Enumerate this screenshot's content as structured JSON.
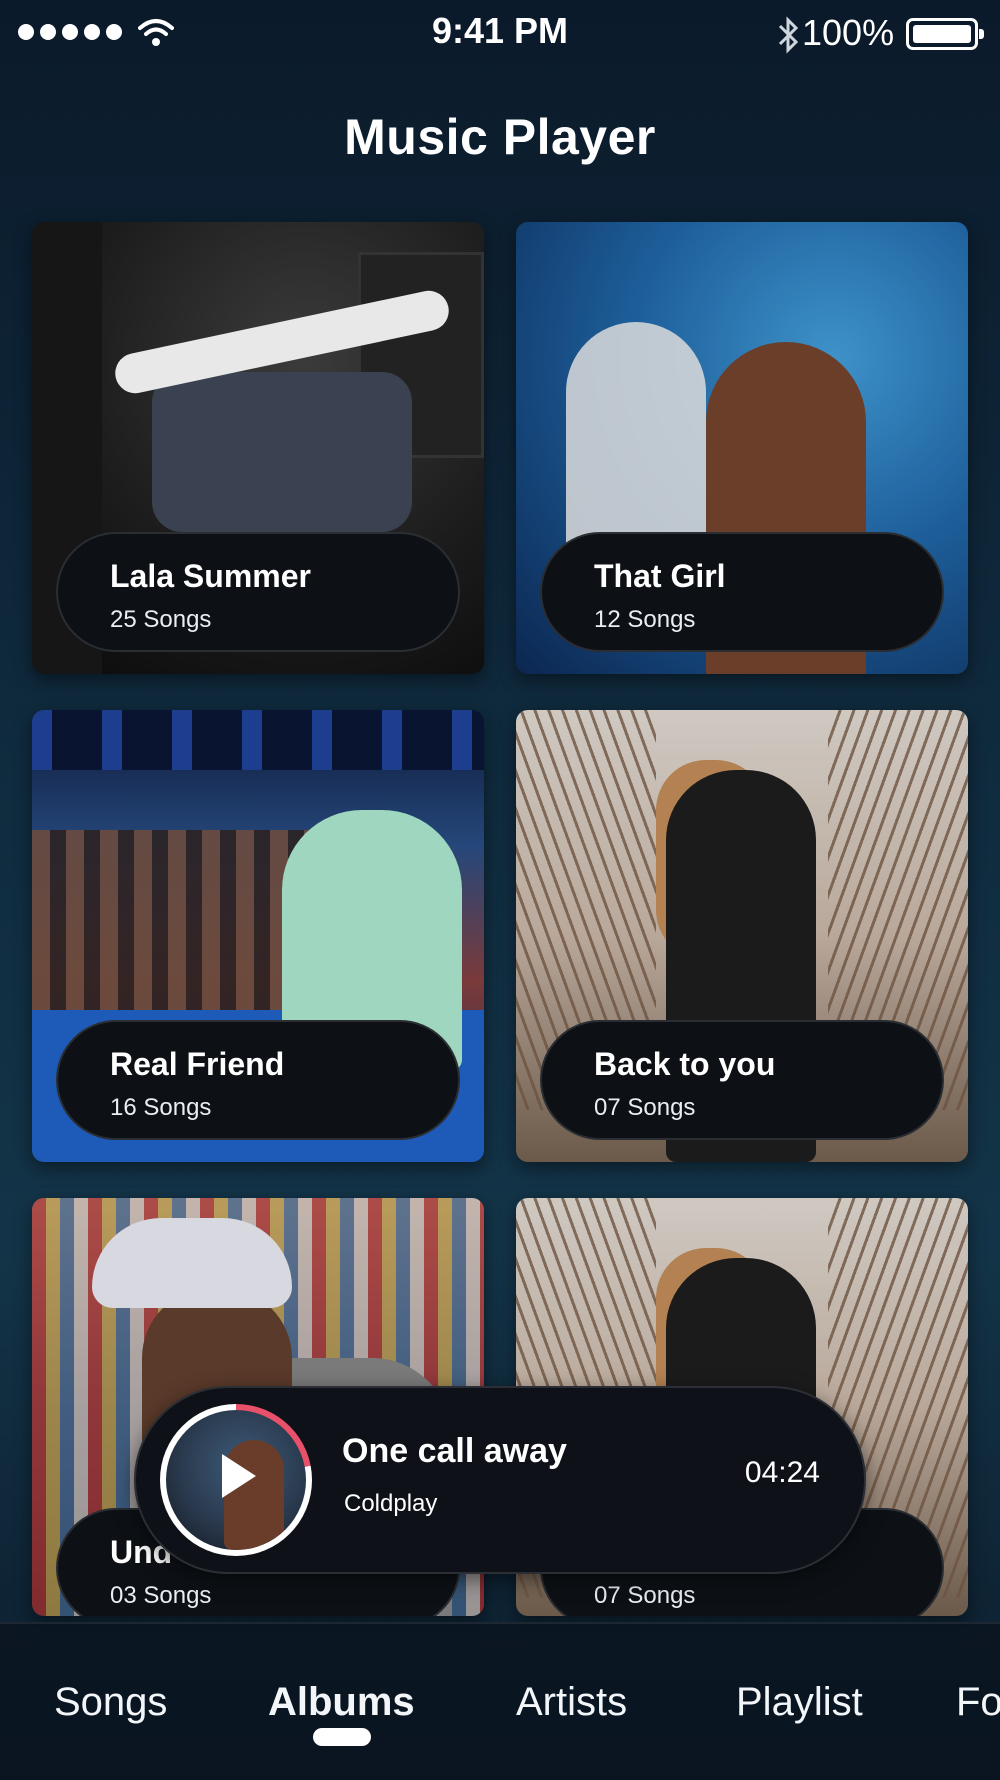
{
  "status_bar": {
    "time": "9:41 PM",
    "battery": "100%"
  },
  "title": "Music Player",
  "albums": [
    {
      "title": "Lala Summer",
      "songs": "25 Songs"
    },
    {
      "title": "That Girl",
      "songs": "12 Songs"
    },
    {
      "title": "Real Friend",
      "songs": "16 Songs"
    },
    {
      "title": "Back to you",
      "songs": "07 Songs"
    },
    {
      "title": "Und",
      "songs": "03 Songs"
    },
    {
      "title": "",
      "songs": "07 Songs"
    }
  ],
  "now_playing": {
    "title": "One call away",
    "artist": "Coldplay",
    "time": "04:24",
    "progress": 0.22
  },
  "tabs": [
    "Songs",
    "Albums",
    "Artists",
    "Playlist",
    "Fo"
  ],
  "active_tab": "Albums",
  "colors": {
    "accent": "#e9506a",
    "pill_bg": "#0d1116"
  },
  "icons": [
    "signal-dots-icon",
    "wifi-icon",
    "bluetooth-icon",
    "battery-icon",
    "play-icon"
  ]
}
